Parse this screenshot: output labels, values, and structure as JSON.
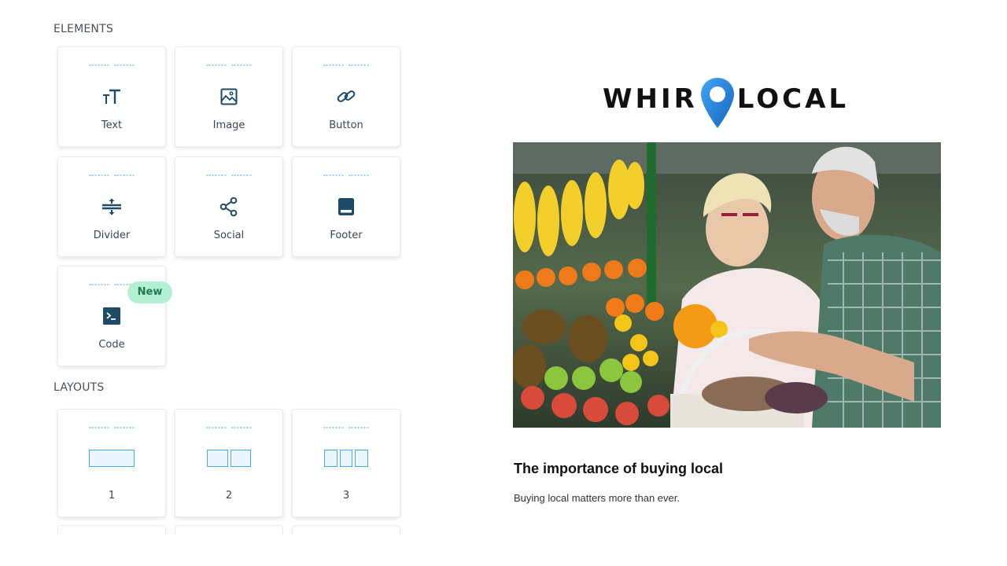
{
  "sidebar": {
    "elements_title": "ELEMENTS",
    "elements": [
      {
        "label": "Text",
        "icon": "text-size-icon"
      },
      {
        "label": "Image",
        "icon": "image-icon"
      },
      {
        "label": "Button",
        "icon": "link-icon"
      },
      {
        "label": "Divider",
        "icon": "divider-icon"
      },
      {
        "label": "Social",
        "icon": "share-icon"
      },
      {
        "label": "Footer",
        "icon": "footer-icon"
      },
      {
        "label": "Code",
        "icon": "terminal-icon",
        "badge": "New"
      }
    ],
    "layouts_title": "LAYOUTS",
    "layouts": [
      {
        "label": "1",
        "columns": 1
      },
      {
        "label": "2",
        "columns": 2
      },
      {
        "label": "3",
        "columns": 3
      }
    ]
  },
  "preview": {
    "logo": {
      "left": "WHIR",
      "right": "LOCAL",
      "pin_color": "#1e88e5"
    },
    "hero_alt": "Senior couple shopping for fruit at a market",
    "article_title": "The importance of buying local",
    "article_body": "Buying local matters more than ever."
  },
  "colors": {
    "icon": "#1d4a66",
    "badge_bg": "#b3f0d3",
    "badge_text": "#1d7a4f",
    "layout_stroke": "#4aa9e0"
  }
}
